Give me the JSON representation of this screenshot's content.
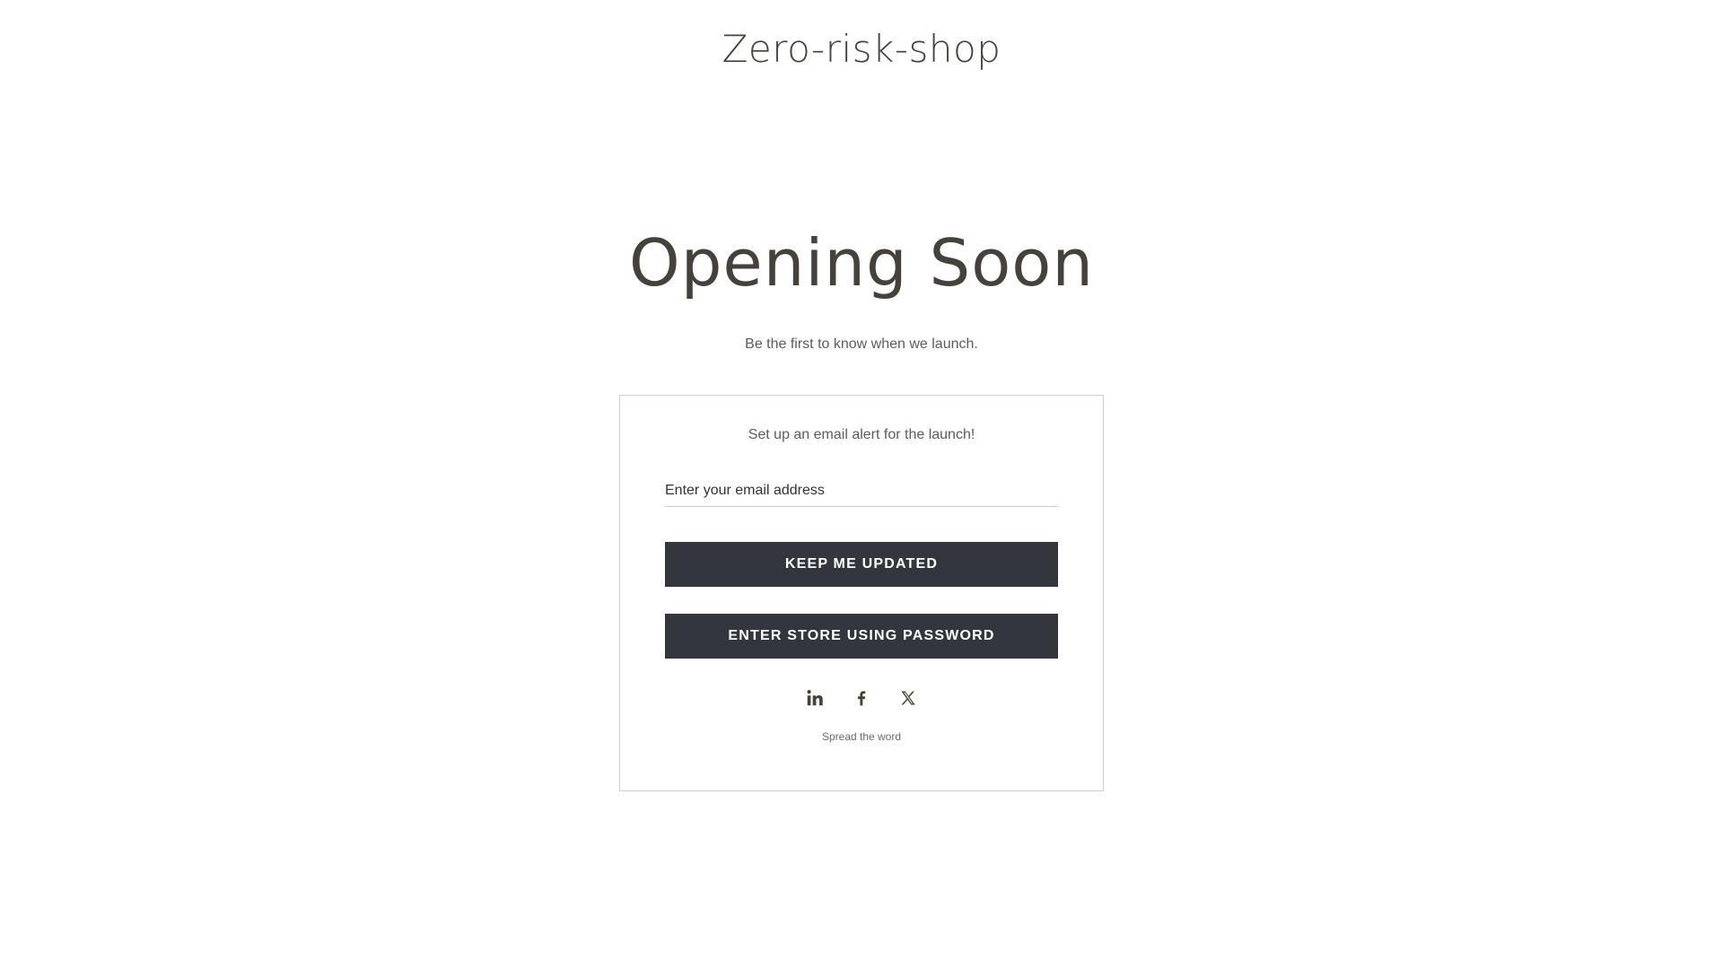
{
  "header": {
    "store_name": "Zero-risk-shop"
  },
  "hero": {
    "heading": "Opening Soon",
    "subheading": "Be the first to know when we launch."
  },
  "signup": {
    "intro": "Set up an email alert for the launch!",
    "email_placeholder": "Enter your email address",
    "email_value": "",
    "keep_updated_label": "KEEP ME UPDATED",
    "enter_store_label": "ENTER STORE USING PASSWORD"
  },
  "social": {
    "icons": [
      "linkedin-icon",
      "facebook-icon",
      "x-icon"
    ],
    "caption": "Spread the word"
  },
  "colors": {
    "text_dark": "#45413b",
    "button_bg": "#33373d",
    "button_text": "#ffffff",
    "card_border": "#cfcfcf"
  }
}
